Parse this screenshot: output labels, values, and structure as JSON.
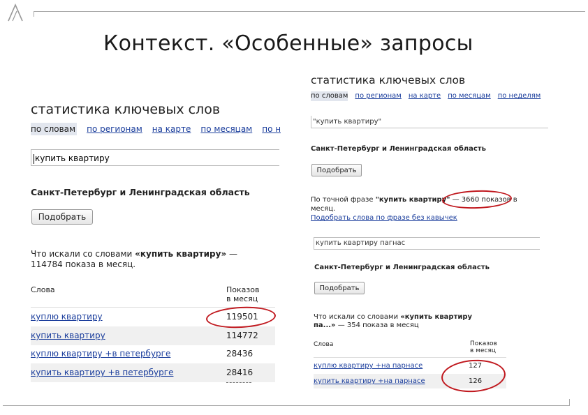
{
  "slide": {
    "title": "Контекст. «Особенные» запросы"
  },
  "left_panel": {
    "heading": "статистика ключевых слов",
    "tabs": [
      "по словам",
      "по регионам",
      "на карте",
      "по месяцам",
      "по не"
    ],
    "search_value": "купить квартиру",
    "region": "Санкт-Петербург и Ленинградская область",
    "button_label": "Подобрать",
    "summary_prefix": "Что искали со словами ",
    "summary_query": "«купить квартиру»",
    "summary_suffix": " — 114784 показа в месяц.",
    "col_words": "Слова",
    "col_shows_1": "Показов",
    "col_shows_2": "в месяц",
    "rows": [
      {
        "word": "куплю квартиру",
        "count": "119501"
      },
      {
        "word": "купить квартиру",
        "count": "114772"
      },
      {
        "word": "куплю квартиру +в петербурге",
        "count": "28436"
      },
      {
        "word": "купить квартиру +в петербурге",
        "count": "28416"
      }
    ]
  },
  "right_panel": {
    "heading": "статистика ключевых слов",
    "tabs": [
      "по словам",
      "по регионам",
      "на карте",
      "по месяцам",
      "по неделям"
    ],
    "search_value_1": "\"купить квартиру\"",
    "region_1": "Санкт-Петербург и Ленинградская область",
    "button_label_1": "Подобрать",
    "phrase_prefix": "По точной фразе ",
    "phrase_query": "\"купить квартиру\"",
    "phrase_suffix": " — 3660 показов в месяц.",
    "phrase_link": "Подобрать слова по фразе без кавычек",
    "search_value_2": "купить квартиру пагнас",
    "region_2": "Санкт-Петербург и Ленинградская область",
    "button_label_2": "Подобрать",
    "summary_prefix": "Что искали со словами ",
    "summary_query": "«купить квартиру па...»",
    "summary_suffix": " — 354 показа в месяц",
    "col_words": "Слова",
    "col_shows_1": "Показов",
    "col_shows_2": "в месяц",
    "rows": [
      {
        "word": "куплю квартиру +на парнасе",
        "count": "127"
      },
      {
        "word": "купить квартиру +на парнасе",
        "count": "126"
      }
    ]
  },
  "colors": {
    "link": "#1a3d9c",
    "annotation": "#c0181e",
    "tab_active_bg": "#e2e6ee"
  }
}
